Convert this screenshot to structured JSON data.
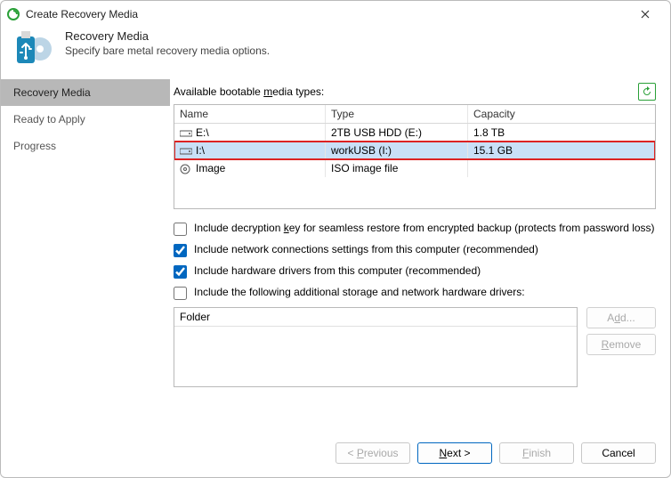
{
  "window": {
    "title": "Create Recovery Media"
  },
  "header": {
    "title": "Recovery Media",
    "subtitle": "Specify bare metal recovery media options."
  },
  "sidebar": {
    "items": [
      {
        "label": "Recovery Media",
        "active": true
      },
      {
        "label": "Ready to Apply",
        "active": false
      },
      {
        "label": "Progress",
        "active": false
      }
    ]
  },
  "media": {
    "section_label_pre": "Available bootable ",
    "section_label_accel": "m",
    "section_label_post": "edia types:",
    "columns": {
      "name": "Name",
      "type": "Type",
      "capacity": "Capacity"
    },
    "rows": [
      {
        "icon": "drive",
        "name": "E:\\",
        "type": "2TB USB HDD (E:)",
        "capacity": "1.8 TB",
        "selected": false
      },
      {
        "icon": "drive",
        "name": "I:\\",
        "type": "workUSB (I:)",
        "capacity": "15.1 GB",
        "selected": true
      },
      {
        "icon": "disc",
        "name": "Image",
        "type": "ISO image file",
        "capacity": "",
        "selected": false
      }
    ]
  },
  "options": {
    "decryption": {
      "checked": false,
      "pre": "Include decryption ",
      "accel": "k",
      "post": "ey for seamless restore from encrypted backup (protects from password loss)"
    },
    "network": {
      "checked": true,
      "text": "Include network connections settings from this computer (recommended)"
    },
    "drivers": {
      "checked": true,
      "text": "Include hardware drivers from this computer (recommended)"
    },
    "additional": {
      "checked": false,
      "text": "Include the following additional storage and network hardware drivers:"
    }
  },
  "folder": {
    "header": "Folder",
    "add_pre": "A",
    "add_accel": "d",
    "add_post": "d...",
    "remove_accel": "R",
    "remove_post": "emove"
  },
  "footer": {
    "previous_pre": "< ",
    "previous_accel": "P",
    "previous_post": "revious",
    "next_accel": "N",
    "next_post": "ext >",
    "finish_accel": "F",
    "finish_post": "inish",
    "cancel": "Cancel"
  },
  "colors": {
    "accent": "#0067c0",
    "selection_bg": "#c9e0f7",
    "highlight_border": "#d22"
  }
}
